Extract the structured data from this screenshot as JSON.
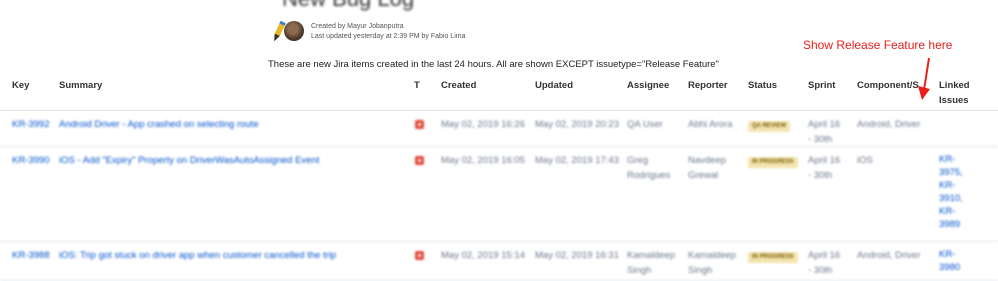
{
  "page": {
    "title": "New Bug Log",
    "created_by": "Created by Mayur Jobanputra",
    "last_updated": "Last updated yesterday at 2:39 PM by Fabio Lima",
    "description": "These are new Jira items created in the last 24 hours. All are shown EXCEPT issuetype=\"Release Feature\"",
    "annotation": "Show Release Feature here"
  },
  "table": {
    "columns": {
      "key": "Key",
      "summary": "Summary",
      "type": "T",
      "created": "Created",
      "updated": "Updated",
      "assignee": "Assignee",
      "reporter": "Reporter",
      "status": "Status",
      "sprint": "Sprint",
      "component": "Component/S",
      "linked_line1": "Linked",
      "linked_line2": "Issues"
    },
    "rows": [
      {
        "key": "KR-3992",
        "summary": "Android Driver - App crashed on selecting route",
        "created": "May 02, 2019 16:26",
        "updated": "May 02, 2019 20:23",
        "assignee_1": "QA User",
        "assignee_2": "",
        "reporter_1": "Abhi Arora",
        "reporter_2": "",
        "status": "QA REVIEW",
        "sprint_1": "April 16",
        "sprint_2": "- 30th",
        "component": "Android, Driver",
        "linked": []
      },
      {
        "key": "KR-3990",
        "summary": "iOS - Add \"Expiry\" Property on DriverWasAutoAssigned Event",
        "created": "May 02, 2019 16:05",
        "updated": "May 02, 2019 17:43",
        "assignee_1": "Greg",
        "assignee_2": "Rodrigues",
        "reporter_1": "Navdeep",
        "reporter_2": "Grewal",
        "status": "IN PROGRESS",
        "sprint_1": "April 16",
        "sprint_2": "- 30th",
        "component": "iOS",
        "linked": [
          "KR-",
          "3975,",
          "KR-",
          "3910,",
          "KR-",
          "3989"
        ]
      },
      {
        "key": "KR-3988",
        "summary": "iOS: Trip got stuck on driver app when customer cancelled the trip",
        "created": "May 02, 2019 15:14",
        "updated": "May 02, 2019 16:31",
        "assignee_1": "Kamaldeep",
        "assignee_2": "Singh",
        "reporter_1": "Kamaldeep",
        "reporter_2": "Singh",
        "status": "IN PROGRESS",
        "sprint_1": "April 16",
        "sprint_2": "- 30th",
        "component": "Android, Driver",
        "linked": [
          "KR-",
          "3980"
        ]
      }
    ]
  },
  "colors": {
    "link": "#0052cc",
    "annotation": "#e8201b",
    "bug_icon": "#e5493a"
  }
}
